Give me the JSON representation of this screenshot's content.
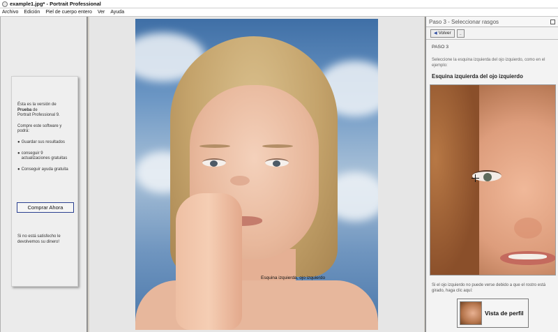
{
  "window": {
    "title": "example1.jpg* - Portrait Professional"
  },
  "menu": {
    "items": [
      "Archivo",
      "Edición",
      "Piel de cuerpo entero",
      "Ver",
      "Ayuda"
    ]
  },
  "left_panel": {
    "trial_line1": "Ésta es la versión de",
    "trial_bold": "Prueba",
    "trial_line2": " de",
    "trial_line3": "Portrait Professional 9.",
    "buy_prompt": "Compre este software y podrá:",
    "benefits": [
      "Guardar sus resultados",
      "conseguir 9 actualizaciones gratuitas",
      "Conseguir ayuda gratuita"
    ],
    "buy_button": "Comprar Ahora",
    "refund": "Si no está satisfecho le devolvemos su dinero!"
  },
  "canvas": {
    "caption": "Esquina izquierda, ojo izquierdo"
  },
  "right_panel": {
    "title": "Paso 3 - Seleccionar rasgos",
    "back_label": "Volver",
    "small_button": "..",
    "step": "PASO 3",
    "instruction": "Seleccione la esquina izquierda del ojo izquierdo, como en el ejemplo:",
    "feature_title": "Esquina izquierda del ojo izquierdo",
    "help": "Si el ojo izquierdo no puede verse debido a que el rostro está girado, haga clic aquí:",
    "profile_button": "Vista de perfil"
  }
}
